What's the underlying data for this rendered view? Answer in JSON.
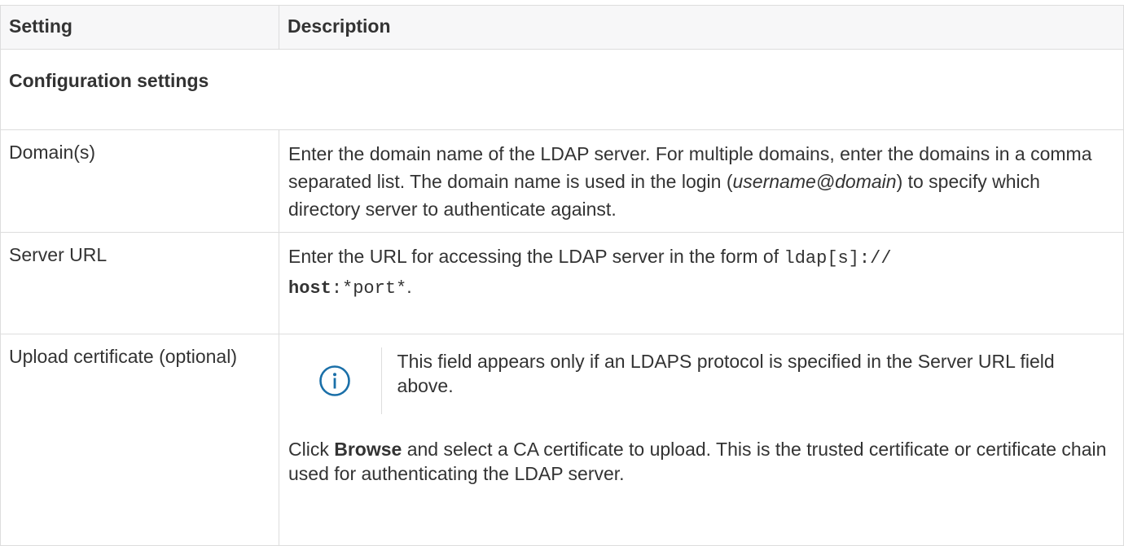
{
  "table": {
    "headers": {
      "setting": "Setting",
      "description": "Description"
    },
    "section_title": "Configuration settings",
    "rows": [
      {
        "setting": "Domain(s)",
        "description": {
          "text_1": "Enter the domain name of the LDAP server. For multiple domains, enter the domains in a comma separated list. The domain name is used in the login (",
          "italic": "username@domain",
          "text_2": ") to specify which directory server to authenticate against."
        }
      },
      {
        "setting": "Server URL",
        "description": {
          "text_1": "Enter the URL for accessing the LDAP server in the form of ",
          "code_1": "ldap[s]://",
          "code_bold": "host",
          "code_2": ":*port*",
          "text_2": "."
        }
      },
      {
        "setting": "Upload certificate (optional)",
        "note": {
          "icon": "info-icon",
          "text": "This field appears only if an LDAPS protocol is specified in the Server URL field above."
        },
        "description": {
          "text_1": "Click ",
          "bold": "Browse",
          "text_2": " and select a CA certificate to upload. This is the trusted certificate or certificate chain used for authenticating the LDAP server."
        }
      }
    ]
  },
  "colors": {
    "text": "#333333",
    "header_bg": "#f7f7f8",
    "border": "#dddddd",
    "info_icon": "#1a6fa8"
  }
}
